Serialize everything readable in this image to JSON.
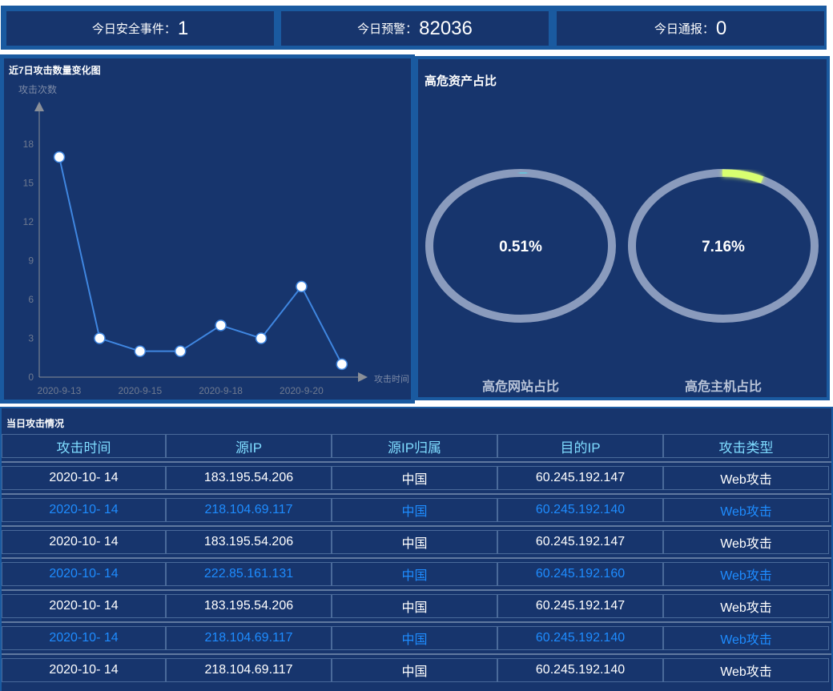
{
  "stats": [
    {
      "label": "今日安全事件：",
      "value": "1"
    },
    {
      "label": "今日预警：",
      "value": "82036"
    },
    {
      "label": "今日通报：",
      "value": "0"
    }
  ],
  "line_panel": {
    "title": "近7日攻击数量变化图"
  },
  "ring_panel": {
    "title": "高危资产占比",
    "rings": [
      {
        "value": "0.51%",
        "label": "高危网站占比",
        "fraction": 0.0051
      },
      {
        "value": "7.16%",
        "label": "高危主机占比",
        "fraction": 0.0716
      }
    ],
    "colors": {
      "track": "#8a9bbd",
      "arc_site": "#48e0f0",
      "arc_host": "#d8ff70"
    }
  },
  "chart_data": {
    "type": "line",
    "title": "近7日攻击数量变化图",
    "xlabel": "攻击时间",
    "ylabel": "攻击次数",
    "x_tick_labels": [
      "2020-9-13",
      "2020-9-15",
      "2020-9-18",
      "2020-9-20"
    ],
    "y_ticks": [
      0,
      3,
      6,
      9,
      12,
      15,
      18
    ],
    "ylim": [
      0,
      20
    ],
    "series": [
      {
        "values": [
          17,
          3,
          2,
          2,
          4,
          3,
          7,
          1
        ]
      }
    ],
    "line_color": "#3f86e0",
    "grid": false
  },
  "table": {
    "title": "当日攻击情况",
    "headers": [
      "攻击时间",
      "源IP",
      "源IP归属",
      "目的IP",
      "攻击类型"
    ],
    "rows": [
      [
        "2020-10- 14",
        "183.195.54.206",
        "中国",
        "60.245.192.147",
        "Web攻击"
      ],
      [
        "2020-10- 14",
        "218.104.69.117",
        "中国",
        "60.245.192.140",
        "Web攻击"
      ],
      [
        "2020-10- 14",
        "183.195.54.206",
        "中国",
        "60.245.192.147",
        "Web攻击"
      ],
      [
        "2020-10- 14",
        "222.85.161.131",
        "中国",
        "60.245.192.160",
        "Web攻击"
      ],
      [
        "2020-10- 14",
        "183.195.54.206",
        "中国",
        "60.245.192.147",
        "Web攻击"
      ],
      [
        "2020-10- 14",
        "218.104.69.117",
        "中国",
        "60.245.192.140",
        "Web攻击"
      ],
      [
        "2020-10- 14",
        "218.104.69.117",
        "中国",
        "60.245.192.140",
        "Web攻击"
      ]
    ]
  }
}
